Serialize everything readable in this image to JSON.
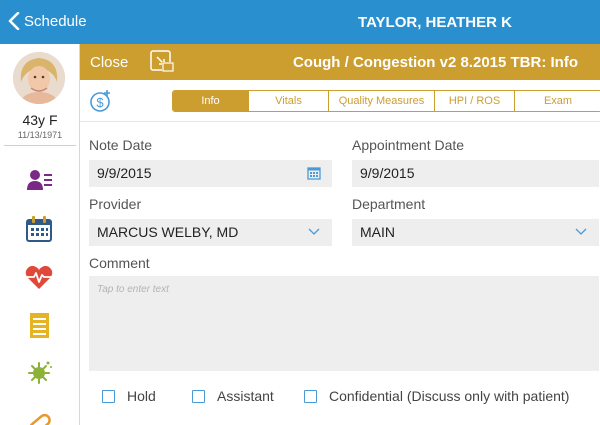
{
  "nav": {
    "back_label": "Schedule",
    "patient_name": "TAYLOR, HEATHER K"
  },
  "patient": {
    "age_sex": "43y F",
    "dob": "11/13/1971"
  },
  "sidebar": {
    "icons": [
      "patient-list-icon",
      "calendar-icon",
      "heart-rate-icon",
      "document-list-icon",
      "virus-icon",
      "pill-icon"
    ]
  },
  "header": {
    "close_label": "Close",
    "note_title": "Cough / Congestion v2 8.2015 TBR: Info"
  },
  "tabs": [
    {
      "label": "Info",
      "active": true
    },
    {
      "label": "Vitals",
      "active": false
    },
    {
      "label": "Quality Measures",
      "active": false
    },
    {
      "label": "HPI / ROS",
      "active": false
    },
    {
      "label": "Exam",
      "active": false
    }
  ],
  "form": {
    "note_date": {
      "label": "Note Date",
      "value": "9/9/2015"
    },
    "appointment_date": {
      "label": "Appointment Date",
      "value": "9/9/2015"
    },
    "provider": {
      "label": "Provider",
      "value": "MARCUS WELBY, MD"
    },
    "department": {
      "label": "Department",
      "value": "MAIN"
    },
    "comment": {
      "label": "Comment",
      "placeholder": "Tap to enter text"
    },
    "checks": [
      {
        "label": "Hold",
        "checked": false
      },
      {
        "label": "Assistant",
        "checked": false
      },
      {
        "label": "Confidential (Discuss only with patient)",
        "checked": false
      }
    ]
  },
  "colors": {
    "nav_blue": "#2a8fcf",
    "gold": "#cc9e30",
    "field_gray": "#eeeeee",
    "checkbox_blue": "#4a9ad6"
  }
}
